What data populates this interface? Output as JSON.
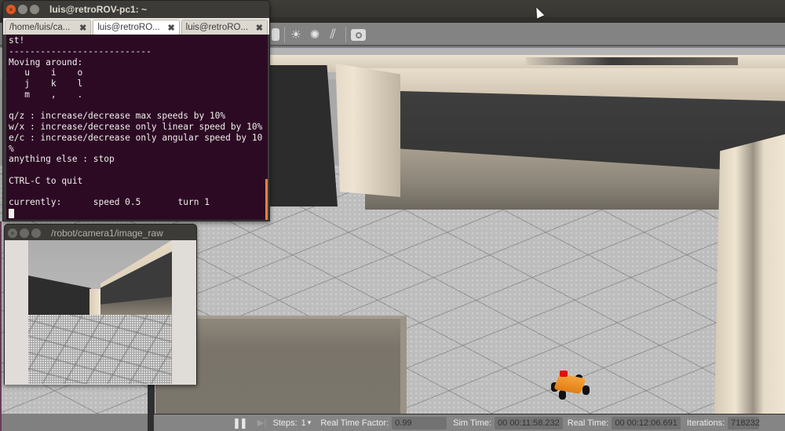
{
  "gazebo": {
    "toolbar": {
      "icons": [
        {
          "name": "cylinder-icon",
          "glyph": "▮"
        },
        {
          "name": "sun-light-icon",
          "glyph": "☀"
        },
        {
          "name": "point-light-icon",
          "glyph": "✺"
        },
        {
          "name": "directional-light-icon",
          "glyph": "⫽"
        },
        {
          "name": "screenshot-camera-icon",
          "glyph": "📷"
        }
      ]
    },
    "statusbar": {
      "pause_glyph": "❚❚",
      "step_glyph": "▶❘",
      "steps_label": "Steps:",
      "steps_value": "1",
      "steps_dropdown_glyph": "▾",
      "rtf_label": "Real Time Factor:",
      "rtf_value": "0.99",
      "sim_time_label": "Sim Time:",
      "sim_time_value": "00 00:11:58.232",
      "real_time_label": "Real Time:",
      "real_time_value": "00 00:12:06.691",
      "iterations_label": "Iterations:",
      "iterations_value": "718232"
    }
  },
  "terminal": {
    "title": "luis@retroROV-pc1: ~",
    "tabs": [
      {
        "label": "/home/luis/ca...",
        "active": false
      },
      {
        "label": "luis@retroRO...",
        "active": true
      },
      {
        "label": "luis@retroRO...",
        "active": false
      }
    ],
    "tab_close_glyph": "✖",
    "lines": [
      "st!",
      "---------------------------",
      "Moving around:",
      "   u    i    o",
      "   j    k    l",
      "   m    ,    .",
      "",
      "q/z : increase/decrease max speeds by 10%",
      "w/x : increase/decrease only linear speed by 10%",
      "e/c : increase/decrease only angular speed by 10",
      "%",
      "anything else : stop",
      "",
      "CTRL-C to quit",
      "",
      "currently:      speed 0.5       turn 1"
    ]
  },
  "camera_window": {
    "title": "/robot/camera1/image_raw"
  },
  "window_buttons": {
    "close": "×",
    "minimize": "–",
    "maximize": "□"
  },
  "colors": {
    "terminal_bg": "#2c0a24",
    "close_button": "#e5561e",
    "robot_body": "#f29227",
    "robot_sensor": "#e01010"
  }
}
